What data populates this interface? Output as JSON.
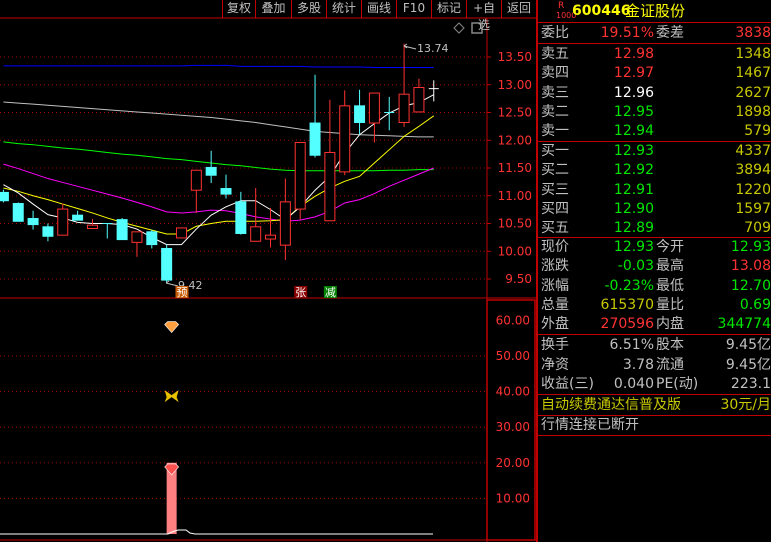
{
  "toolbar": {
    "buttons": [
      "复权",
      "叠加",
      "多股",
      "统计",
      "画线",
      "F10",
      "标记",
      "+自选",
      "返回"
    ]
  },
  "colors": {
    "up": "#ff3232",
    "down": "#54ffff",
    "ma5": "#ffffff",
    "ma10": "#ffff00",
    "ma20": "#ff00ff",
    "ma60": "#00ff00",
    "ma120": "#c0c0c0",
    "ma250": "#0000ff",
    "axis": "#c00000",
    "label": "#ff3232"
  },
  "chart_data": [
    {
      "type": "candlestick",
      "y_ticks": [
        "13.50",
        "13.00",
        "12.50",
        "12.00",
        "11.50",
        "11.00",
        "10.50",
        "10.00",
        "9.50"
      ],
      "ylim": [
        9.35,
        13.95
      ],
      "high_label": "13.74",
      "low_label": "9.42",
      "candles": [
        [
          11.06,
          11.11,
          10.88,
          10.91
        ],
        [
          10.86,
          10.88,
          10.54,
          10.54
        ],
        [
          10.59,
          10.73,
          10.39,
          10.48
        ],
        [
          10.44,
          10.5,
          10.18,
          10.27
        ],
        [
          10.29,
          10.86,
          10.29,
          10.76
        ],
        [
          10.65,
          10.73,
          10.56,
          10.56
        ],
        [
          10.41,
          10.58,
          10.41,
          10.47
        ],
        [
          10.5,
          10.5,
          10.23,
          10.49
        ],
        [
          10.57,
          10.6,
          10.21,
          10.21
        ],
        [
          10.16,
          10.35,
          9.9,
          10.35
        ],
        [
          10.35,
          10.39,
          10.05,
          10.12
        ],
        [
          10.05,
          10.12,
          9.42,
          9.48
        ],
        [
          10.24,
          10.42,
          10.24,
          10.42
        ],
        [
          11.1,
          11.46,
          10.69,
          11.46
        ],
        [
          11.51,
          11.81,
          11.23,
          11.37
        ],
        [
          11.13,
          11.38,
          10.95,
          11.03
        ],
        [
          10.89,
          11.07,
          10.3,
          10.32
        ],
        [
          10.18,
          11.14,
          10.18,
          10.44
        ],
        [
          10.22,
          10.78,
          10.07,
          10.29
        ],
        [
          10.11,
          11.31,
          9.84,
          10.89
        ],
        [
          10.76,
          11.96,
          10.57,
          11.96
        ],
        [
          12.31,
          13.18,
          11.69,
          11.73
        ],
        [
          10.55,
          12.73,
          10.55,
          11.78
        ],
        [
          11.43,
          12.9,
          11.37,
          12.62
        ],
        [
          12.62,
          12.91,
          12.1,
          12.32
        ],
        [
          12.31,
          12.85,
          11.96,
          12.85
        ],
        [
          12.5,
          12.78,
          12.18,
          12.5
        ],
        [
          12.32,
          13.74,
          12.24,
          12.83
        ],
        [
          12.51,
          13.11,
          12.51,
          12.95
        ],
        [
          12.93,
          13.08,
          12.7,
          12.93
        ]
      ],
      "ma": {
        "ma5": [
          11.2,
          11.05,
          10.85,
          10.66,
          10.6,
          10.52,
          10.5,
          10.5,
          10.48,
          10.4,
          10.25,
          10.12,
          10.12,
          10.4,
          10.65,
          10.8,
          10.91,
          10.91,
          10.75,
          10.57,
          10.8,
          11.1,
          11.35,
          11.77,
          12.1,
          12.3,
          12.49,
          12.62,
          12.68,
          12.82
        ],
        "ma10": [
          11.14,
          11.08,
          11.0,
          10.93,
          10.85,
          10.77,
          10.69,
          10.6,
          10.52,
          10.45,
          10.38,
          10.31,
          10.31,
          10.45,
          10.5,
          10.54,
          10.54,
          10.54,
          10.55,
          10.57,
          10.81,
          10.99,
          11.14,
          11.26,
          11.35,
          11.59,
          11.83,
          12.07,
          12.25,
          12.44
        ],
        "ma20": [
          11.57,
          11.49,
          11.4,
          11.31,
          11.24,
          11.17,
          11.1,
          11.03,
          10.96,
          10.88,
          10.8,
          10.71,
          10.69,
          10.71,
          10.74,
          10.73,
          10.68,
          10.62,
          10.58,
          10.54,
          10.56,
          10.62,
          10.72,
          10.87,
          10.93,
          11.04,
          11.17,
          11.28,
          11.39,
          11.5
        ],
        "ma60": [
          11.97,
          11.94,
          11.92,
          11.89,
          11.86,
          11.84,
          11.81,
          11.78,
          11.75,
          11.73,
          11.7,
          11.67,
          11.65,
          11.62,
          11.59,
          11.56,
          11.54,
          11.51,
          11.48,
          11.46,
          11.45,
          11.45,
          11.45,
          11.45,
          11.45,
          11.45,
          11.46,
          11.46,
          11.47,
          11.47
        ],
        "ma120": [
          12.69,
          12.67,
          12.65,
          12.63,
          12.61,
          12.59,
          12.57,
          12.55,
          12.53,
          12.51,
          12.49,
          12.47,
          12.45,
          12.43,
          12.41,
          12.38,
          12.35,
          12.32,
          12.28,
          12.24,
          12.2,
          12.16,
          12.14,
          12.12,
          12.1,
          12.09,
          12.08,
          12.07,
          12.06,
          12.06
        ],
        "ma250": [
          13.34,
          13.34,
          13.34,
          13.34,
          13.34,
          13.34,
          13.34,
          13.34,
          13.34,
          13.34,
          13.34,
          13.34,
          13.34,
          13.35,
          13.35,
          13.35,
          13.33,
          13.33,
          13.33,
          13.33,
          13.33,
          13.32,
          13.32,
          13.32,
          13.32,
          13.31,
          13.31,
          13.31,
          13.31,
          13.31
        ]
      },
      "signals": [
        {
          "index": 12,
          "text": "预",
          "color": "#c85a00"
        },
        {
          "index": 20,
          "text": "张",
          "color": "#8b0000"
        },
        {
          "index": 22,
          "text": "减",
          "color": "#008000"
        }
      ]
    },
    {
      "type": "bar",
      "y_ticks": [
        "60.00",
        "50.00",
        "40.00",
        "30.00",
        "20.00",
        "10.00"
      ],
      "ylim": [
        0,
        65
      ],
      "bars": [
        {
          "index": 11,
          "value": 20
        }
      ],
      "icons": [
        {
          "index": 11,
          "value": 58,
          "name": "diamond-orange"
        },
        {
          "index": 11,
          "value": 39,
          "name": "butterfly"
        },
        {
          "index": 11,
          "value": 18,
          "name": "diamond-red"
        }
      ]
    }
  ],
  "quote": {
    "badge_top": "R",
    "badge_bottom": "1000",
    "code": "600446",
    "name": "金证股份",
    "weibi": {
      "label": "委比",
      "value": "19.51%",
      "label2": "委差",
      "value2": "3838"
    },
    "asks": [
      {
        "label": "卖五",
        "price": "12.98",
        "vol": "1348",
        "c": "red"
      },
      {
        "label": "卖四",
        "price": "12.97",
        "vol": "1467",
        "c": "red"
      },
      {
        "label": "卖三",
        "price": "12.96",
        "vol": "2627",
        "c": "wht"
      },
      {
        "label": "卖二",
        "price": "12.95",
        "vol": "1898",
        "c": "grn"
      },
      {
        "label": "卖一",
        "price": "12.94",
        "vol": "579",
        "c": "grn"
      }
    ],
    "bids": [
      {
        "label": "买一",
        "price": "12.93",
        "vol": "4337",
        "c": "grn"
      },
      {
        "label": "买二",
        "price": "12.92",
        "vol": "3894",
        "c": "grn"
      },
      {
        "label": "买三",
        "price": "12.91",
        "vol": "1220",
        "c": "grn"
      },
      {
        "label": "买四",
        "price": "12.90",
        "vol": "1597",
        "c": "grn"
      },
      {
        "label": "买五",
        "price": "12.89",
        "vol": "709",
        "c": "grn"
      }
    ],
    "stats": [
      {
        "l1": "现价",
        "v1": "12.93",
        "c1": "grn",
        "l2": "今开",
        "v2": "12.93",
        "c2": "grn"
      },
      {
        "l1": "涨跌",
        "v1": "-0.03",
        "c1": "grn",
        "l2": "最高",
        "v2": "13.08",
        "c2": "red"
      },
      {
        "l1": "涨幅",
        "v1": "-0.23%",
        "c1": "grn",
        "l2": "最低",
        "v2": "12.70",
        "c2": "grn"
      },
      {
        "l1": "总量",
        "v1": "615370",
        "c1": "yel",
        "l2": "量比",
        "v2": "0.69",
        "c2": "grn"
      },
      {
        "l1": "外盘",
        "v1": "270596",
        "c1": "red",
        "l2": "内盘",
        "v2": "344774",
        "c2": "grn"
      }
    ],
    "fund": [
      {
        "l1": "换手",
        "v1": "6.51%",
        "l2": "股本",
        "v2": "9.45亿"
      },
      {
        "l1": "净资",
        "v1": "3.78",
        "l2": "流通",
        "v2": "9.45亿"
      },
      {
        "l1": "收益(三)",
        "v1": "0.040",
        "l2": "PE(动)",
        "v2": "223.1"
      }
    ],
    "promo": "自动续费通达信普及版",
    "promo_price": "30元/月",
    "status": "行情连接已断开"
  }
}
